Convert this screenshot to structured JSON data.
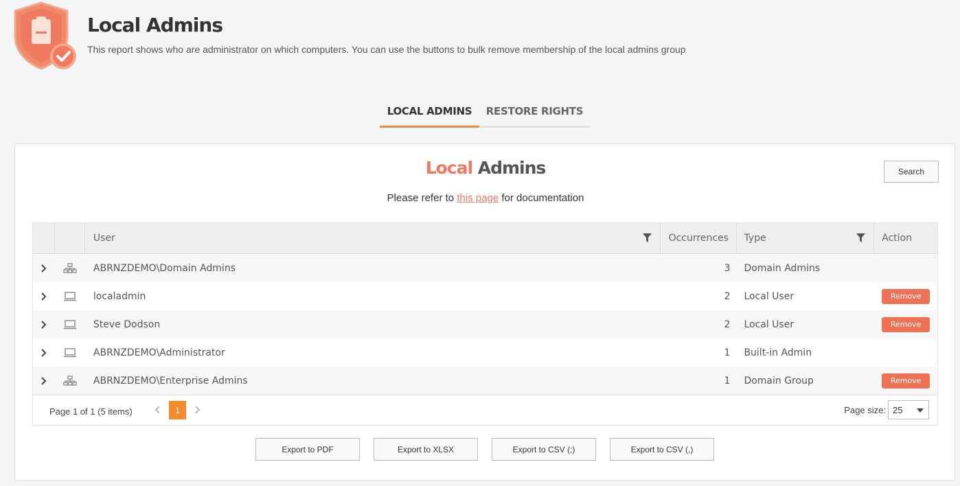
{
  "header": {
    "title": "Local Admins",
    "description": "This report shows who are administrator on which computers. You can use the buttons to bulk remove membership of the local admins group",
    "logo_icon": "shield-clipboard-check-icon"
  },
  "tabs": [
    {
      "label": "LOCAL ADMINS",
      "active": true
    },
    {
      "label": "RESTORE RIGHTS",
      "active": false
    }
  ],
  "card": {
    "title_part1": "Local",
    "title_part2": " Admins",
    "search_label": "Search",
    "doc_prefix": "Please refer to ",
    "doc_link": "this page",
    "doc_suffix": " for documentation"
  },
  "grid": {
    "columns": {
      "user": "User",
      "occurrences": "Occurrences",
      "type": "Type",
      "action": "Action"
    },
    "rows": [
      {
        "icon": "network-group-icon",
        "user": "ABRNZDEMO\\Domain Admins",
        "occurrences": "3",
        "type": "Domain Admins",
        "action": ""
      },
      {
        "icon": "laptop-icon",
        "user": "localadmin",
        "occurrences": "2",
        "type": "Local User",
        "action": "Remove"
      },
      {
        "icon": "laptop-icon",
        "user": "Steve Dodson",
        "occurrences": "2",
        "type": "Local User",
        "action": "Remove"
      },
      {
        "icon": "laptop-icon",
        "user": "ABRNZDEMO\\Administrator",
        "occurrences": "1",
        "type": "Built-in Admin",
        "action": ""
      },
      {
        "icon": "network-group-icon",
        "user": "ABRNZDEMO\\Enterprise Admins",
        "occurrences": "1",
        "type": "Domain Group",
        "action": "Remove"
      }
    ],
    "pager": {
      "info": "Page 1 of 1 (5 items)",
      "current_page": "1",
      "page_size_label": "Page size:",
      "page_size": "25"
    }
  },
  "exports": [
    {
      "label": "Export to PDF"
    },
    {
      "label": "Export to XLSX"
    },
    {
      "label": "Export to CSV (;)"
    },
    {
      "label": "Export to CSV (,)"
    }
  ],
  "colors": {
    "accent_orange": "#f58b2c",
    "accent_salmon": "#ef7a5f",
    "remove_button": "#ef7256"
  }
}
